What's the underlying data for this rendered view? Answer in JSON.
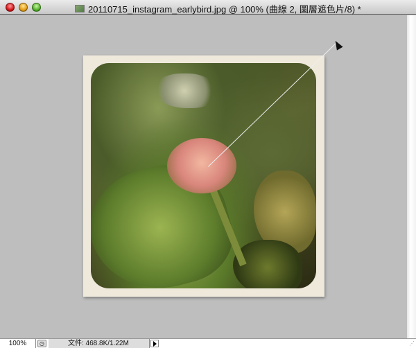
{
  "window": {
    "title": "20110715_instagram_earlybird.jpg @ 100% (曲線 2, 圖層遮色片/8) *"
  },
  "status": {
    "zoom": "100%",
    "doc_info": "文件: 468.8K/1.22M"
  }
}
